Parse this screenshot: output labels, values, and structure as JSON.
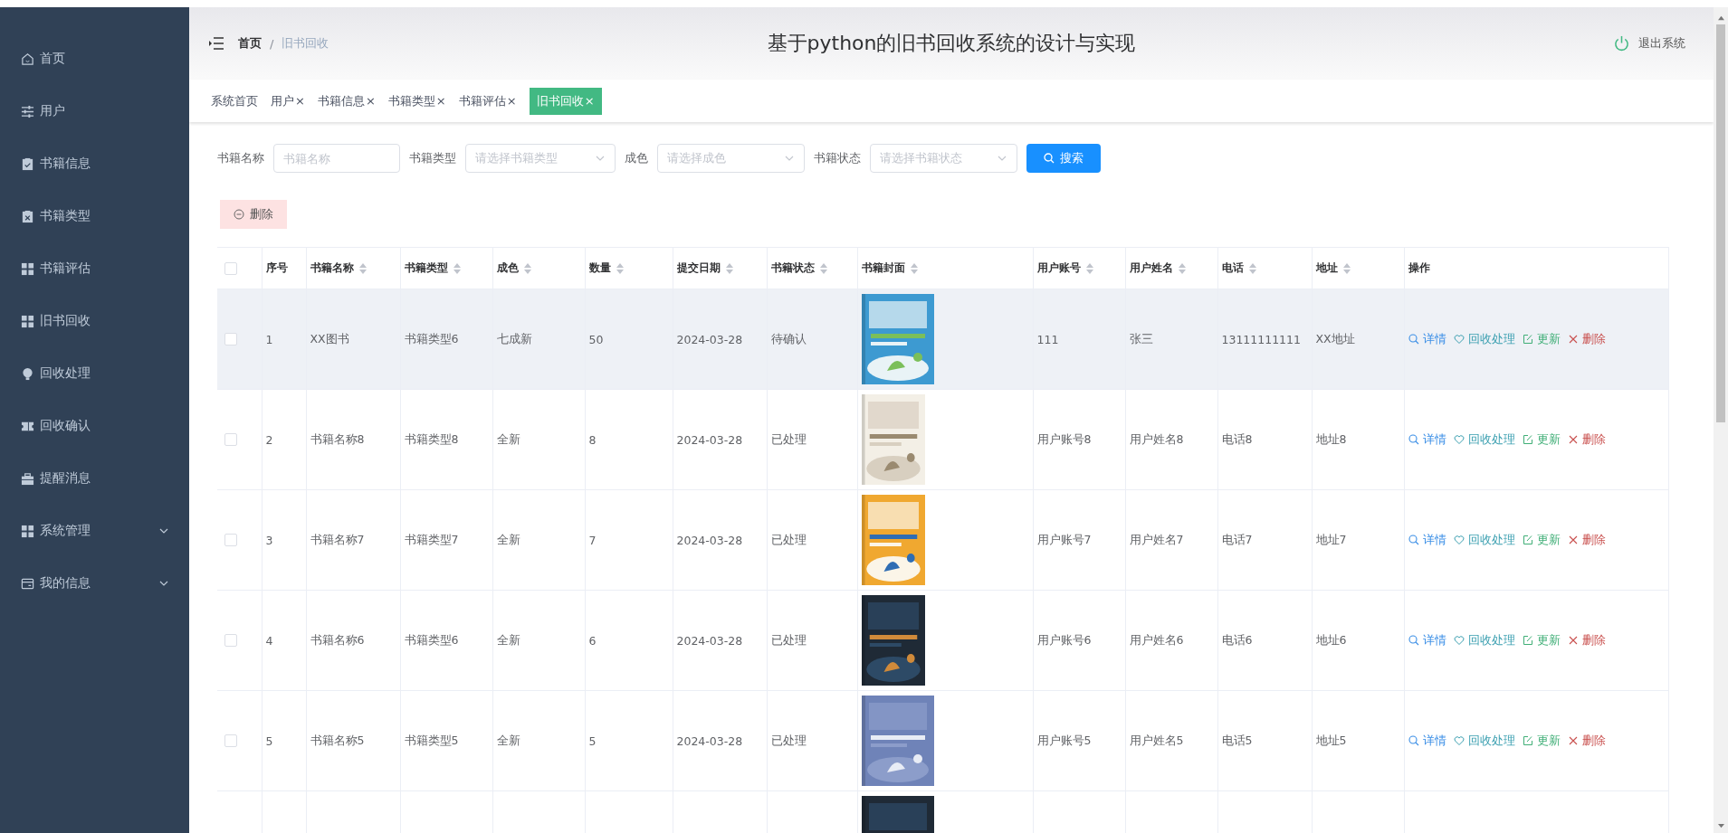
{
  "sidebar": {
    "items": [
      {
        "label": "首页"
      },
      {
        "label": "用户"
      },
      {
        "label": "书籍信息"
      },
      {
        "label": "书籍类型"
      },
      {
        "label": "书籍评估"
      },
      {
        "label": "旧书回收"
      },
      {
        "label": "回收处理"
      },
      {
        "label": "回收确认"
      },
      {
        "label": "提醒消息"
      },
      {
        "label": "系统管理",
        "expanded": false
      },
      {
        "label": "我的信息",
        "expanded": false
      }
    ]
  },
  "header": {
    "breadcrumb": [
      "首页",
      "旧书回收"
    ],
    "breadcrumb_separator": "/",
    "title": "基于python的旧书回收系统的设计与实现",
    "logout": "退出系统"
  },
  "tabs": [
    {
      "label": "系统首页",
      "closable": false,
      "selected": false
    },
    {
      "label": "用户",
      "closable": true,
      "selected": false
    },
    {
      "label": "书籍信息",
      "closable": true,
      "selected": false
    },
    {
      "label": "书籍类型",
      "closable": true,
      "selected": false
    },
    {
      "label": "书籍评估",
      "closable": true,
      "selected": false
    },
    {
      "label": "旧书回收",
      "closable": true,
      "selected": true
    }
  ],
  "close_mark": "×",
  "filters": [
    {
      "kind": "input",
      "label": "书籍名称",
      "placeholder": "书籍名称"
    },
    {
      "kind": "select",
      "label": "书籍类型",
      "placeholder": "请选择书籍类型"
    },
    {
      "kind": "select",
      "label": "成色",
      "placeholder": "请选择成色"
    },
    {
      "kind": "select",
      "label": "书籍状态",
      "placeholder": "请选择书籍状态"
    }
  ],
  "search_button": "搜索",
  "delete_button": "删除",
  "table": {
    "select_all": {
      "checked": false
    },
    "columns": [
      {
        "label": "序号",
        "sortable": false
      },
      {
        "label": "书籍名称",
        "sortable": true
      },
      {
        "label": "书籍类型",
        "sortable": true
      },
      {
        "label": "成色",
        "sortable": true
      },
      {
        "label": "数量",
        "sortable": true
      },
      {
        "label": "提交日期",
        "sortable": true
      },
      {
        "label": "书籍状态",
        "sortable": true
      },
      {
        "label": "书籍封面",
        "sortable": true
      },
      {
        "label": "用户账号",
        "sortable": true
      },
      {
        "label": "用户姓名",
        "sortable": true
      },
      {
        "label": "电话",
        "sortable": true
      },
      {
        "label": "地址",
        "sortable": true
      },
      {
        "label": "操作",
        "sortable": false
      }
    ],
    "rows": [
      {
        "checked": false,
        "hovered": true,
        "cells": [
          "1",
          "XX图书",
          "书籍类型6",
          "七成新",
          "50",
          "2024-03-28",
          "待确认",
          null,
          "111",
          "张三",
          "13111111111",
          "XX地址"
        ],
        "cover": {
          "kind": "picture"
        },
        "actions": [
          {
            "kind": "detail",
            "label": "详情"
          },
          {
            "kind": "process",
            "label": "回收处理"
          },
          {
            "kind": "update",
            "label": "更新"
          },
          {
            "kind": "delete",
            "label": "删除"
          }
        ]
      },
      {
        "checked": false,
        "hovered": false,
        "cells": [
          "2",
          "书籍名称8",
          "书籍类型8",
          "全新",
          "8",
          "2024-03-28",
          "已处理",
          null,
          "用户账号8",
          "用户姓名8",
          "电话8",
          "地址8"
        ],
        "cover": {
          "kind": "picture"
        },
        "actions": [
          {
            "kind": "detail",
            "label": "详情"
          },
          {
            "kind": "process",
            "label": "回收处理"
          },
          {
            "kind": "update",
            "label": "更新"
          },
          {
            "kind": "delete",
            "label": "删除"
          }
        ]
      },
      {
        "checked": false,
        "hovered": false,
        "cells": [
          "3",
          "书籍名称7",
          "书籍类型7",
          "全新",
          "7",
          "2024-03-28",
          "已处理",
          null,
          "用户账号7",
          "用户姓名7",
          "电话7",
          "地址7"
        ],
        "cover": {
          "kind": "picture"
        },
        "actions": [
          {
            "kind": "detail",
            "label": "详情"
          },
          {
            "kind": "process",
            "label": "回收处理"
          },
          {
            "kind": "update",
            "label": "更新"
          },
          {
            "kind": "delete",
            "label": "删除"
          }
        ]
      },
      {
        "checked": false,
        "hovered": false,
        "cells": [
          "4",
          "书籍名称6",
          "书籍类型6",
          "全新",
          "6",
          "2024-03-28",
          "已处理",
          null,
          "用户账号6",
          "用户姓名6",
          "电话6",
          "地址6"
        ],
        "cover": {
          "kind": "picture"
        },
        "actions": [
          {
            "kind": "detail",
            "label": "详情"
          },
          {
            "kind": "process",
            "label": "回收处理"
          },
          {
            "kind": "update",
            "label": "更新"
          },
          {
            "kind": "delete",
            "label": "删除"
          }
        ]
      },
      {
        "checked": false,
        "hovered": false,
        "cells": [
          "5",
          "书籍名称5",
          "书籍类型5",
          "全新",
          "5",
          "2024-03-28",
          "已处理",
          null,
          "用户账号5",
          "用户姓名5",
          "电话5",
          "地址5"
        ],
        "cover": {
          "kind": "picture"
        },
        "actions": [
          {
            "kind": "detail",
            "label": "详情"
          },
          {
            "kind": "process",
            "label": "回收处理"
          },
          {
            "kind": "update",
            "label": "更新"
          },
          {
            "kind": "delete",
            "label": "删除"
          }
        ]
      },
      {
        "cover": {
          "kind": "picture"
        }
      }
    ]
  }
}
